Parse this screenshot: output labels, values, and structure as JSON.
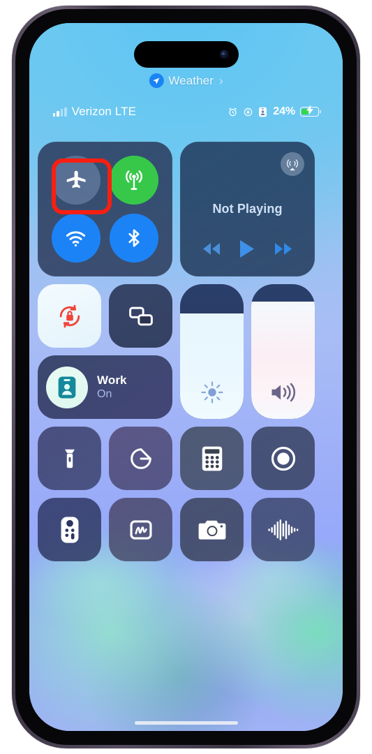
{
  "device": {
    "name": "iphone-14-pro",
    "frame_color": "#4b4353"
  },
  "back_to_app": {
    "label": "Weather",
    "chevron": "›",
    "icon": "location-arrow-icon"
  },
  "status_bar": {
    "carrier": "Verizon LTE",
    "signal_bars_active": 2,
    "signal_bars_total": 4,
    "icons": [
      "alarm-clock-icon",
      "rotation-lock-icon",
      "focus-badge-icon"
    ],
    "battery_percent": "24%",
    "battery_level": 24,
    "charging": true,
    "battery_color": "#32d74b"
  },
  "control_center": {
    "connectivity": {
      "toggles": [
        {
          "name": "airplane-mode",
          "label": "Airplane Mode",
          "state": "off",
          "color": "#768cb2",
          "highlighted": true
        },
        {
          "name": "cellular-data",
          "label": "Cellular Data",
          "state": "on",
          "color": "#37c84a",
          "highlighted": false
        },
        {
          "name": "wifi",
          "label": "Wi-Fi",
          "state": "on",
          "color": "#1c83f6",
          "highlighted": false
        },
        {
          "name": "bluetooth",
          "label": "Bluetooth",
          "state": "on",
          "color": "#1c83f6",
          "highlighted": false
        }
      ],
      "highlight_color": "#f81f12"
    },
    "media": {
      "now_playing": "Not Playing",
      "airplay_icon": "airplay-audio-icon",
      "controls": [
        "rewind-button",
        "play-button",
        "fast-forward-button"
      ]
    },
    "rotation_lock": {
      "label": "Rotation Lock",
      "state": "on",
      "icon_color": "#f0443a"
    },
    "screen_mirroring": {
      "label": "Screen Mirroring",
      "state": "off"
    },
    "focus": {
      "name": "Work",
      "state": "On",
      "icon": "focus-badge-icon"
    },
    "brightness": {
      "label": "Brightness",
      "value": 78
    },
    "volume": {
      "label": "Volume",
      "value": 87
    },
    "utilities": [
      {
        "name": "flashlight",
        "label": "Flashlight",
        "icon": "flashlight-icon"
      },
      {
        "name": "timer",
        "label": "Timer",
        "icon": "timer-icon"
      },
      {
        "name": "calculator",
        "label": "Calculator",
        "icon": "calculator-icon"
      },
      {
        "name": "screen-recording",
        "label": "Screen Recording",
        "icon": "record-icon"
      },
      {
        "name": "apple-tv-remote",
        "label": "Apple TV Remote",
        "icon": "remote-icon"
      },
      {
        "name": "quick-note",
        "label": "Quick Note",
        "icon": "quicknote-icon"
      },
      {
        "name": "camera",
        "label": "Camera",
        "icon": "camera-icon"
      },
      {
        "name": "sound-recognition",
        "label": "Sound Recognition",
        "icon": "waveform-icon"
      }
    ]
  }
}
